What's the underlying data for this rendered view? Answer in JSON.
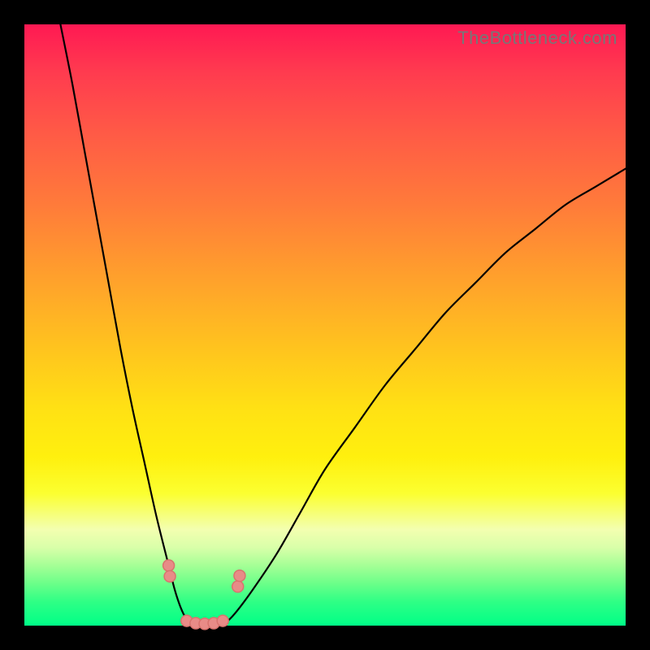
{
  "watermark": "TheBottleneck.com",
  "chart_data": {
    "type": "line",
    "title": "",
    "xlabel": "",
    "ylabel": "",
    "xlim": [
      0,
      100
    ],
    "ylim": [
      0,
      100
    ],
    "background_gradient": {
      "top_color": "#ff1953",
      "mid_color": "#fff00e",
      "bottom_color": "#00ff87"
    },
    "series": [
      {
        "name": "left-curve",
        "x": [
          6,
          8,
          10,
          12,
          14,
          16,
          18,
          20,
          22,
          24,
          25,
          26,
          27,
          28
        ],
        "y": [
          100,
          90,
          79,
          68,
          57,
          46,
          36,
          27,
          18,
          10,
          6,
          3,
          1,
          0
        ]
      },
      {
        "name": "right-curve",
        "x": [
          33,
          35,
          38,
          42,
          46,
          50,
          55,
          60,
          65,
          70,
          75,
          80,
          85,
          90,
          95,
          100
        ],
        "y": [
          0,
          2,
          6,
          12,
          19,
          26,
          33,
          40,
          46,
          52,
          57,
          62,
          66,
          70,
          73,
          76
        ]
      }
    ],
    "flat_segment": {
      "x": [
        28,
        33
      ],
      "y": [
        0,
        0
      ]
    },
    "markers": [
      {
        "name": "left-upper-cluster",
        "cx": 24.0,
        "cy": 10.0
      },
      {
        "name": "left-upper-cluster-b",
        "cx": 24.2,
        "cy": 8.2
      },
      {
        "name": "bottom-cluster-1",
        "cx": 27.0,
        "cy": 0.8
      },
      {
        "name": "bottom-cluster-2",
        "cx": 28.5,
        "cy": 0.4
      },
      {
        "name": "bottom-cluster-3",
        "cx": 30.0,
        "cy": 0.3
      },
      {
        "name": "bottom-cluster-4",
        "cx": 31.5,
        "cy": 0.4
      },
      {
        "name": "bottom-cluster-5",
        "cx": 33.0,
        "cy": 0.8
      },
      {
        "name": "right-upper-cluster",
        "cx": 35.5,
        "cy": 6.5
      },
      {
        "name": "right-upper-cluster-b",
        "cx": 35.8,
        "cy": 8.3
      }
    ],
    "marker_style": {
      "fill": "#e88b87",
      "stroke": "#d8736e",
      "radius_px": 7
    }
  }
}
